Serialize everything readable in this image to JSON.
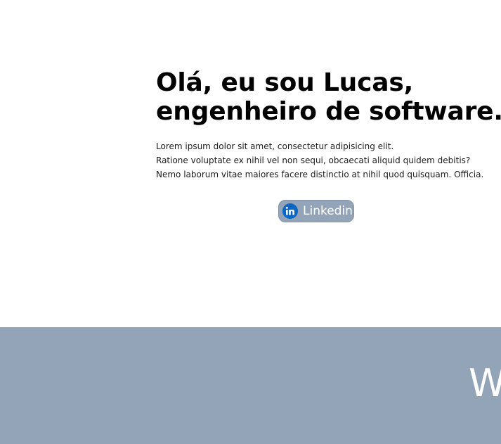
{
  "hero": {
    "title_line1": "Olá, eu sou Lucas,",
    "title_line2": "engenheiro de software.",
    "description_line1": "Lorem ipsum dolor sit amet, consectetur adipisicing elit.",
    "description_line2": "Ratione voluptate ex nihil vel non sequi, obcaecati aliquid quidem debitis?",
    "description_line3": "Nemo laborum vitae maiores facere distinctio at nihil quod quisquam. Officia.",
    "linkedin_button": {
      "label": "Linkedin",
      "icon": "linkedin-icon"
    }
  },
  "section": {
    "heading_visible": "W"
  },
  "colors": {
    "band_background": "#93a4b8",
    "button_background": "#93a4b8",
    "linkedin_brand": "#0a66c2",
    "title_text": "#000000",
    "body_text": "#1b1b1b"
  }
}
